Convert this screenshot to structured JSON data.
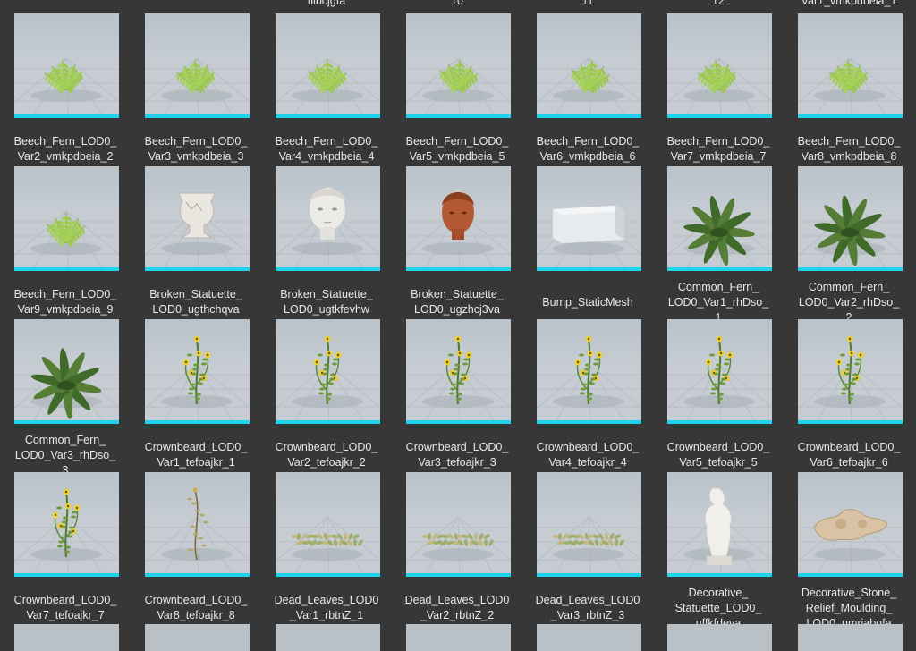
{
  "content_browser": {
    "partial_top_labels": [
      "tiibcjgfa",
      "10",
      "11",
      "12",
      "Var1_vmkpdbeia_1"
    ],
    "assets": [
      {
        "name": "Beech_Fern_LOD0_Var2_vmkpdbeia_2",
        "label": "Beech_Fern_LOD0_\nVar2_vmkpdbeia_2",
        "icon": "fern"
      },
      {
        "name": "Beech_Fern_LOD0_Var3_vmkpdbeia_3",
        "label": "Beech_Fern_LOD0_\nVar3_vmkpdbeia_3",
        "icon": "fern"
      },
      {
        "name": "Beech_Fern_LOD0_Var4_vmkpdbeia_4",
        "label": "Beech_Fern_LOD0_\nVar4_vmkpdbeia_4",
        "icon": "fern"
      },
      {
        "name": "Beech_Fern_LOD0_Var5_vmkpdbeia_5",
        "label": "Beech_Fern_LOD0_\nVar5_vmkpdbeia_5",
        "icon": "fern"
      },
      {
        "name": "Beech_Fern_LOD0_Var6_vmkpdbeia_6",
        "label": "Beech_Fern_LOD0_\nVar6_vmkpdbeia_6",
        "icon": "fern"
      },
      {
        "name": "Beech_Fern_LOD0_Var7_vmkpdbeia_7",
        "label": "Beech_Fern_LOD0_\nVar7_vmkpdbeia_7",
        "icon": "fern"
      },
      {
        "name": "Beech_Fern_LOD0_Var8_vmkpdbeia_8",
        "label": "Beech_Fern_LOD0_\nVar8_vmkpdbeia_8",
        "icon": "fern"
      },
      {
        "name": "Beech_Fern_LOD0_Var9_vmkpdbeia_9",
        "label": "Beech_Fern_LOD0_\nVar9_vmkpdbeia_9",
        "icon": "fern"
      },
      {
        "name": "Broken_Statuette_LOD0_ugthchqva",
        "label": "Broken_Statuette_\nLOD0_ugthchqva",
        "icon": "vase"
      },
      {
        "name": "Broken_Statuette_LOD0_ugtkfevhw",
        "label": "Broken_Statuette_\nLOD0_ugtkfevhw",
        "icon": "head-white"
      },
      {
        "name": "Broken_Statuette_LOD0_ugzhcj3va",
        "label": "Broken_Statuette_\nLOD0_ugzhcj3va",
        "icon": "head-terracotta"
      },
      {
        "name": "Bump_StaticMesh",
        "label": "Bump_StaticMesh",
        "icon": "box"
      },
      {
        "name": "Common_Fern_LOD0_Var1_rhDso_1",
        "label": "Common_Fern_\nLOD0_Var1_rhDso_\n1",
        "icon": "fern-dark"
      },
      {
        "name": "Common_Fern_LOD0_Var2_rhDso_2",
        "label": "Common_Fern_\nLOD0_Var2_rhDso_\n2",
        "icon": "fern-dark"
      },
      {
        "name": "Common_Fern_LOD0_Var3_rhDso_3",
        "label": "Common_Fern_\nLOD0_Var3_rhDso_\n3",
        "icon": "fern-dark"
      },
      {
        "name": "Crownbeard_LOD0_Var1_tefoajkr_1",
        "label": "Crownbeard_LOD0_\nVar1_tefoajkr_1",
        "icon": "flower"
      },
      {
        "name": "Crownbeard_LOD0_Var2_tefoajkr_2",
        "label": "Crownbeard_LOD0_\nVar2_tefoajkr_2",
        "icon": "flower"
      },
      {
        "name": "Crownbeard_LOD0_Var3_tefoajkr_3",
        "label": "Crownbeard_LOD0_\nVar3_tefoajkr_3",
        "icon": "flower"
      },
      {
        "name": "Crownbeard_LOD0_Var4_tefoajkr_4",
        "label": "Crownbeard_LOD0_\nVar4_tefoajkr_4",
        "icon": "flower"
      },
      {
        "name": "Crownbeard_LOD0_Var5_tefoajkr_5",
        "label": "Crownbeard_LOD0_\nVar5_tefoajkr_5",
        "icon": "flower"
      },
      {
        "name": "Crownbeard_LOD0_Var6_tefoajkr_6",
        "label": "Crownbeard_LOD0_\nVar6_tefoajkr_6",
        "icon": "flower"
      },
      {
        "name": "Crownbeard_LOD0_Var7_tefoajkr_7",
        "label": "Crownbeard_LOD0_\nVar7_tefoajkr_7",
        "icon": "flower"
      },
      {
        "name": "Crownbeard_LOD0_Var8_tefoajkr_8",
        "label": "Crownbeard_LOD0_\nVar8_tefoajkr_8",
        "icon": "flower-dry"
      },
      {
        "name": "Dead_Leaves_LOD0_Var1_rbtnZ_1",
        "label": "Dead_Leaves_LOD0\n_Var1_rbtnZ_1",
        "icon": "leaves"
      },
      {
        "name": "Dead_Leaves_LOD0_Var2_rbtnZ_2",
        "label": "Dead_Leaves_LOD0\n_Var2_rbtnZ_2",
        "icon": "leaves"
      },
      {
        "name": "Dead_Leaves_LOD0_Var3_rbtnZ_3",
        "label": "Dead_Leaves_LOD0\n_Var3_rbtnZ_3",
        "icon": "leaves"
      },
      {
        "name": "Decorative_Statuette_LOD0_uffkfdeva",
        "label": "Decorative_\nStatuette_LOD0_\nuffkfdeva",
        "icon": "torso"
      },
      {
        "name": "Decorative_Stone_Relief_Moulding_LOD0_umriabgfa",
        "label": "Decorative_Stone_\nRelief_Moulding_\nLOD0_umriabgfa",
        "icon": "relief"
      }
    ]
  },
  "colors": {
    "background": "#373737",
    "accent_bar": "#1fd3ea",
    "label_text": "#e8e8e8"
  }
}
